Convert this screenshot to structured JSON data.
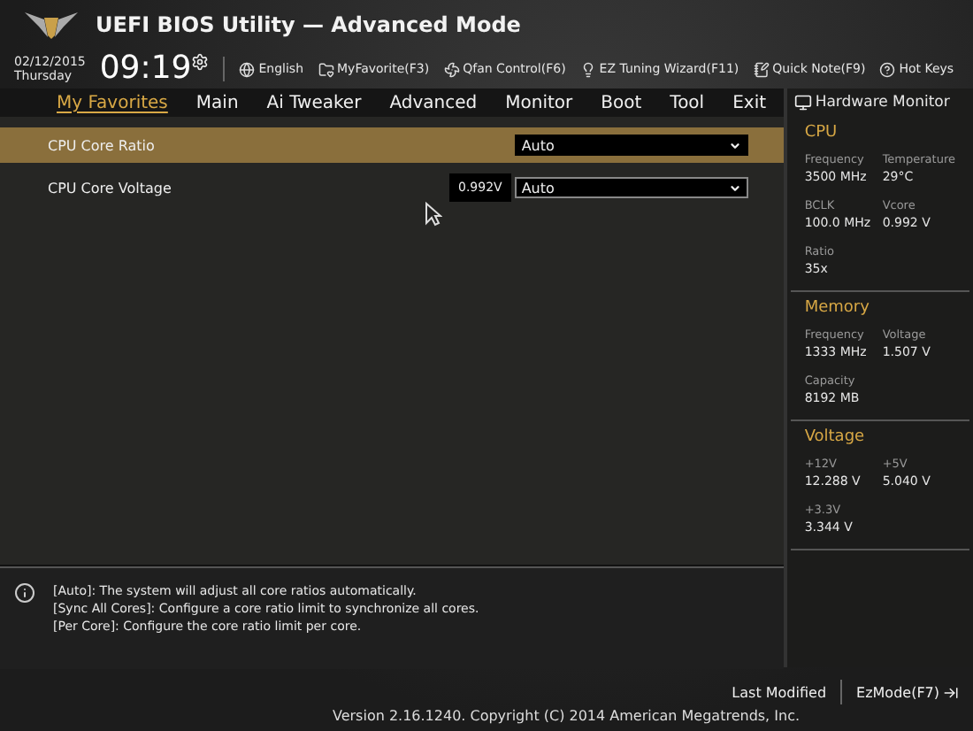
{
  "header": {
    "title": "UEFI BIOS Utility — Advanced Mode",
    "date": "02/12/2015",
    "day": "Thursday",
    "time": "09:19"
  },
  "toolbar": [
    {
      "label": "English",
      "kind": "globe"
    },
    {
      "label": "MyFavorite(F3)",
      "kind": "favorite"
    },
    {
      "label": "Qfan Control(F6)",
      "kind": "fan"
    },
    {
      "label": "EZ Tuning Wizard(F11)",
      "kind": "bulb"
    },
    {
      "label": "Quick Note(F9)",
      "kind": "note"
    },
    {
      "label": "Hot Keys",
      "kind": "help"
    }
  ],
  "tabs": [
    {
      "label": "My Favorites",
      "selected": true
    },
    {
      "label": "Main",
      "selected": false
    },
    {
      "label": "Ai Tweaker",
      "selected": false
    },
    {
      "label": "Advanced",
      "selected": false
    },
    {
      "label": "Monitor",
      "selected": false
    },
    {
      "label": "Boot",
      "selected": false
    },
    {
      "label": "Tool",
      "selected": false
    },
    {
      "label": "Exit",
      "selected": false
    }
  ],
  "settings": [
    {
      "label": "CPU Core Ratio",
      "selected": true,
      "value": "Auto"
    },
    {
      "label": "CPU Core Voltage",
      "selected": false,
      "reading": "0.992V",
      "value": "Auto"
    }
  ],
  "help_lines": [
    "[Auto]: The system will adjust all core ratios automatically.",
    "[Sync All Cores]: Configure a core ratio limit to synchronize all cores.",
    "[Per Core]: Configure the core ratio limit per core."
  ],
  "hardware_monitor": {
    "title": "Hardware Monitor",
    "sections": [
      {
        "title": "CPU",
        "items": [
          {
            "label": "Frequency",
            "value": "3500 MHz"
          },
          {
            "label": "Temperature",
            "value": "29°C"
          },
          {
            "label": "BCLK",
            "value": "100.0 MHz"
          },
          {
            "label": "Vcore",
            "value": "0.992 V"
          },
          {
            "label": "Ratio",
            "value": "35x"
          }
        ]
      },
      {
        "title": "Memory",
        "items": [
          {
            "label": "Frequency",
            "value": "1333 MHz"
          },
          {
            "label": "Voltage",
            "value": "1.507 V"
          },
          {
            "label": "Capacity",
            "value": "8192 MB"
          }
        ]
      },
      {
        "title": "Voltage",
        "items": [
          {
            "label": "+12V",
            "value": "12.288 V"
          },
          {
            "label": "+5V",
            "value": "5.040 V"
          },
          {
            "label": "+3.3V",
            "value": "3.344 V"
          }
        ]
      }
    ]
  },
  "footer": {
    "version": "Version 2.16.1240. Copyright (C) 2014 American Megatrends, Inc.",
    "last_modified": "Last Modified",
    "ez_mode": "EzMode(F7)"
  }
}
